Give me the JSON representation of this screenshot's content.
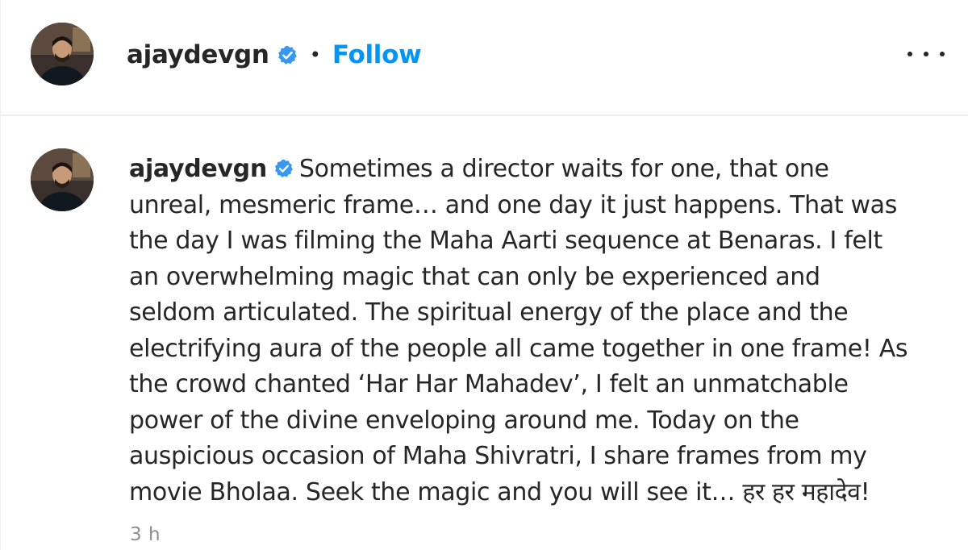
{
  "post": {
    "header": {
      "username": "ajaydevgn",
      "separator": "•",
      "follow_label": "Follow",
      "verified_icon": "verified-badge-icon",
      "more_icon": "more-options-icon"
    },
    "caption": {
      "username": "ajaydevgn",
      "lines": [
        "Sometimes a director waits for one, that one",
        "unreal, mesmeric frame… and one day it just happens. That was",
        "the day I was filming the Maha Aarti sequence at Benaras. I felt",
        "an overwhelming magic that can only be experienced and",
        "seldom articulated. The spiritual energy of the place and the",
        "electrifying aura of the people all came together in one frame! As",
        "the crowd chanted ‘Har Har Mahadev’, I felt an unmatchable",
        "power of the divine enveloping around me. Today on the",
        "auspicious occasion of Maha Shivratri, I share frames from my",
        "movie Bholaa. Seek the magic and you will see it… हर हर महादेव!"
      ]
    },
    "timestamp": "3 h",
    "colors": {
      "accent": "#0095f6",
      "text": "#262626",
      "muted": "#8e8e8e",
      "verified": "#3897f0"
    }
  }
}
